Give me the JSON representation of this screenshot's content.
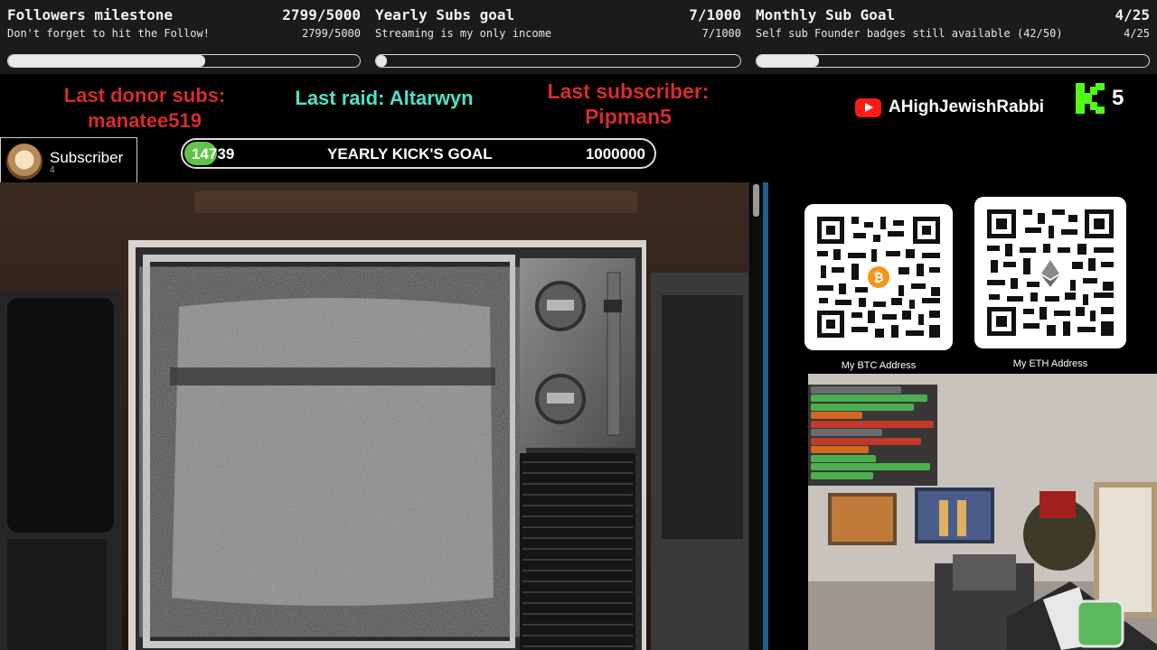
{
  "goals": [
    {
      "title": "Followers milestone",
      "value": "2799/5000",
      "subtitle": "Don't forget to hit the Follow!",
      "progress": 0.5598
    },
    {
      "title": "Yearly Subs goal",
      "value": "7/1000",
      "subtitle": "Streaming is my only income",
      "progress": 0.007
    },
    {
      "title": "Monthly Sub Goal",
      "value": "4/25",
      "subtitle": "Self sub Founder badges still available (42/50)",
      "progress": 0.16
    }
  ],
  "last_donor": {
    "label": "Last donor subs:",
    "name": "manatee519"
  },
  "last_raid": "Last raid: Altarwyn",
  "last_subscriber": {
    "label": "Last subscriber:",
    "name": "Pipman5"
  },
  "youtube": {
    "channel": "AHighJewishRabbi"
  },
  "kick": {
    "count": "5"
  },
  "subscriber_box": {
    "label": "Subscriber",
    "count": "4"
  },
  "kick_goal": {
    "current": "14739",
    "title": "YEARLY KICK'S GOAL",
    "target": "1000000",
    "progress": 0.0147
  },
  "qr": [
    {
      "caption": "My BTC Address",
      "coin_icon": "bitcoin-icon",
      "badge_color": "#f7931a"
    },
    {
      "caption": "My ETH Address",
      "coin_icon": "ethereum-icon",
      "badge_color": "#8a8a8a"
    }
  ],
  "colors": {
    "red": "#d42d2d",
    "teal": "#4fe0c8",
    "kick_green": "#53fc18",
    "youtube_red": "#ff1a1a",
    "goal_fill": "#5fc348"
  }
}
